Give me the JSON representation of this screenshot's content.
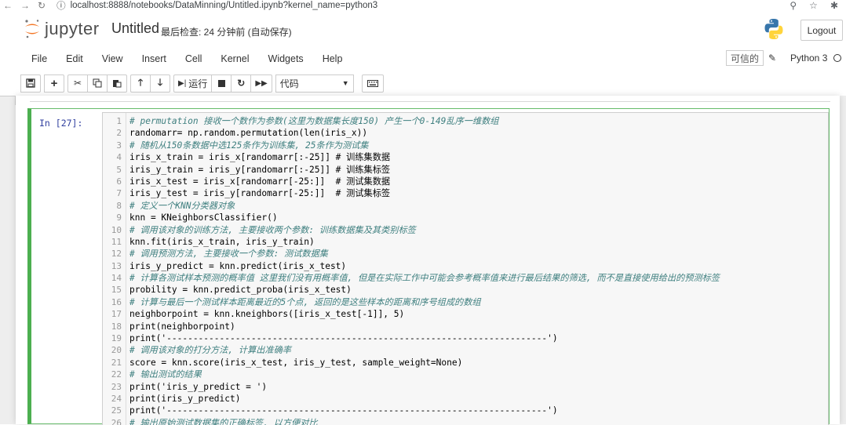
{
  "browser": {
    "url": "localhost:8888/notebooks/DataMinning/Untitled.ipynb?kernel_name=python3"
  },
  "header": {
    "logo_text": "jupyter",
    "notebook_title": "Untitled",
    "checkpoint": "最后检查: 24 分钟前  (自动保存)",
    "logout_label": "Logout"
  },
  "menu": [
    "File",
    "Edit",
    "View",
    "Insert",
    "Cell",
    "Kernel",
    "Widgets",
    "Help"
  ],
  "kernel": {
    "trusted_label": "可信的",
    "name": "Python 3"
  },
  "toolbar": {
    "run_label": "运行",
    "cell_type": "代码"
  },
  "cell": {
    "prompt": "In  [27]:",
    "lines": [
      {
        "n": "1",
        "text": "# permutation 接收一个数作为参数(这里为数据集长度150) 产生一个0-149乱序一维数组",
        "comment": true
      },
      {
        "n": "2",
        "text": "randomarr= np.random.permutation(len(iris_x))",
        "comment": false
      },
      {
        "n": "3",
        "text": "# 随机从150条数据中选125条作为训练集, 25条作为测试集",
        "comment": true
      },
      {
        "n": "4",
        "text": "iris_x_train = iris_x[randomarr[:-25]] # 训练集数据",
        "comment": false
      },
      {
        "n": "5",
        "text": "iris_y_train = iris_y[randomarr[:-25]] # 训练集标签",
        "comment": false
      },
      {
        "n": "6",
        "text": "iris_x_test = iris_x[randomarr[-25:]]  # 测试集数据",
        "comment": false
      },
      {
        "n": "7",
        "text": "iris_y_test = iris_y[randomarr[-25:]]  # 测试集标签",
        "comment": false
      },
      {
        "n": "8",
        "text": "# 定义一个KNN分类器对象",
        "comment": true
      },
      {
        "n": "9",
        "text": "knn = KNeighborsClassifier()",
        "comment": false
      },
      {
        "n": "10",
        "text": "# 调用该对象的训练方法, 主要接收两个参数: 训练数据集及其类别标签",
        "comment": true
      },
      {
        "n": "11",
        "text": "knn.fit(iris_x_train, iris_y_train)",
        "comment": false
      },
      {
        "n": "12",
        "text": "# 调用预测方法, 主要接收一个参数: 测试数据集",
        "comment": true
      },
      {
        "n": "13",
        "text": "iris_y_predict = knn.predict(iris_x_test)",
        "comment": false
      },
      {
        "n": "14",
        "text": "# 计算各测试样本预测的概率值 这里我们没有用概率值, 但是在实际工作中可能会参考概率值来进行最后结果的筛选, 而不是直接使用给出的预测标签",
        "comment": true
      },
      {
        "n": "15",
        "text": "probility = knn.predict_proba(iris_x_test)",
        "comment": false
      },
      {
        "n": "16",
        "text": "# 计算与最后一个测试样本距离最近的5个点, 返回的是这些样本的距离和序号组成的数组",
        "comment": true
      },
      {
        "n": "17",
        "text": "neighborpoint = knn.kneighbors([iris_x_test[-1]], 5)",
        "comment": false
      },
      {
        "n": "18",
        "text": "print(neighborpoint)",
        "comment": false
      },
      {
        "n": "19",
        "text": "print('------------------------------------------------------------------------')",
        "comment": false
      },
      {
        "n": "20",
        "text": "# 调用该对象的打分方法, 计算出准确率",
        "comment": true
      },
      {
        "n": "21",
        "text": "score = knn.score(iris_x_test, iris_y_test, sample_weight=None)",
        "comment": false
      },
      {
        "n": "22",
        "text": "# 输出测试的结果",
        "comment": true
      },
      {
        "n": "23",
        "text": "print('iris_y_predict = ')",
        "comment": false
      },
      {
        "n": "24",
        "text": "print(iris_y_predict)",
        "comment": false
      },
      {
        "n": "25",
        "text": "print('------------------------------------------------------------------------')",
        "comment": false
      },
      {
        "n": "26",
        "text": "# 输出原始测试数据集的正确标签, 以方便对比",
        "comment": true
      }
    ]
  }
}
